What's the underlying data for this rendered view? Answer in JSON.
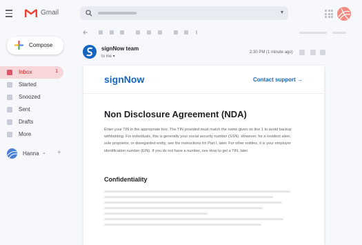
{
  "app": {
    "name": "Gmail"
  },
  "search": {
    "caret": "▾"
  },
  "compose": {
    "label": "Compose"
  },
  "nav": [
    {
      "label": "Inbox",
      "count": "1",
      "active": true
    },
    {
      "label": "Started"
    },
    {
      "label": "Snoozed"
    },
    {
      "label": "Sent"
    },
    {
      "label": "Drafts"
    },
    {
      "label": "More"
    }
  ],
  "user": {
    "name": "Hanna",
    "chevron": "⌄",
    "add": "+"
  },
  "message": {
    "sender": "signNow team",
    "to": "to me ▾",
    "time": "2:30 PM (1 minute ago)"
  },
  "email": {
    "logo": "signNow",
    "contact": "Contact support →",
    "title": "Non Disclosure Agreement (NDA)",
    "body": "Enter your TIN in the appropriate box. The TIN provided must match the name given on line 1 to avoid backup withholding. For individuals, this is generally your social security number (SSN). However, for a resident alien, sole proprietor, or disregarded entity, see the instructions for Part I, later. For other entities, it is your employer identification number (EIN). If you do not have a number, see How to get a TIN, later.",
    "section": "Confidentiality"
  },
  "colors": {
    "accent": "#1565c0",
    "gmail_red": "#ea4335",
    "inbox_bg": "#f8d7da"
  }
}
